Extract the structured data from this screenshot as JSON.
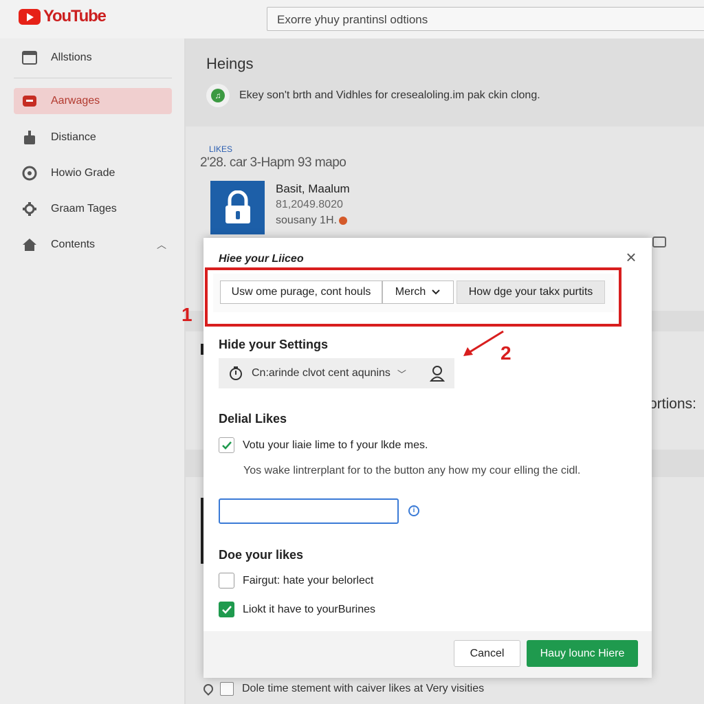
{
  "app": {
    "logo_text": "YouTube",
    "brand_color": "#e62117"
  },
  "search": {
    "placeholder": "Exorre yhuy prantinsl odtions"
  },
  "sidebar": {
    "items": [
      {
        "label": "Allstions",
        "icon": "video-grid-icon"
      },
      {
        "label": "Aarwages",
        "icon": "youtube-logo-icon",
        "active": true
      },
      {
        "label": "Distiance",
        "icon": "person-badge-icon"
      },
      {
        "label": "Howio Grade",
        "icon": "circle-icon"
      },
      {
        "label": "Graam Tages",
        "icon": "gear-icon"
      },
      {
        "label": "Contents",
        "icon": "home-icon",
        "expanded": true
      }
    ]
  },
  "main": {
    "title": "Heings",
    "info_text": "Ekey son't brth and Vidhles for cresealoling.im pak ckin clong.",
    "likes_label": "LIKES",
    "likes_count": "2'28. car 3-Hapm 93 mapo",
    "channel": {
      "name": "Basit, Maalum",
      "number": "81,2049.8020",
      "subtitle": "sousany 1H."
    },
    "options_text": "ortions:",
    "bottom_row_text": "Dole time stement with caiver likes at Very visities"
  },
  "modal": {
    "title": "Hiee your Liiceo",
    "segments": [
      "Usw ome purage, cont houls",
      "Merch",
      "How dge your takx purtits"
    ],
    "settings_title": "Hide your Settings",
    "settings_value": "Cn:arinde clvot cent aqunins",
    "likes_title": "Delial Likes",
    "likes_checkbox": "Votu your liaie lime to f your lkde mes.",
    "likes_description": "Yos wake lintrerplant for to the button any how my cour elling the cidl.",
    "do_likes_title": "Doe your likes",
    "checkbox_a": "Fairgut: hate your belorlect",
    "checkbox_b": "Liokt it have to yourBurines",
    "cancel_label": "Cancel",
    "confirm_label": "Hauy lounc Hiere",
    "accent_color": "#1f9a4e"
  },
  "annotations": {
    "step1": "1",
    "step2": "2",
    "color": "#d81e1e"
  }
}
